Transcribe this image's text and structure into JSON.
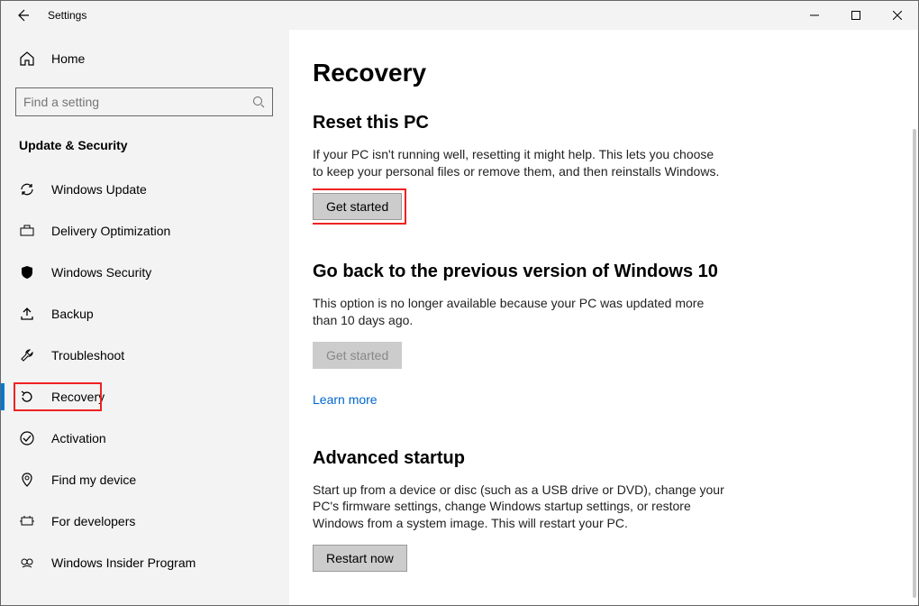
{
  "window": {
    "title": "Settings"
  },
  "home_label": "Home",
  "search": {
    "placeholder": "Find a setting"
  },
  "category": "Update & Security",
  "nav": [
    {
      "id": "windows-update",
      "label": "Windows Update"
    },
    {
      "id": "delivery-optimization",
      "label": "Delivery Optimization"
    },
    {
      "id": "windows-security",
      "label": "Windows Security"
    },
    {
      "id": "backup",
      "label": "Backup"
    },
    {
      "id": "troubleshoot",
      "label": "Troubleshoot"
    },
    {
      "id": "recovery",
      "label": "Recovery",
      "active": true
    },
    {
      "id": "activation",
      "label": "Activation"
    },
    {
      "id": "find-my-device",
      "label": "Find my device"
    },
    {
      "id": "for-developers",
      "label": "For developers"
    },
    {
      "id": "windows-insider",
      "label": "Windows Insider Program"
    }
  ],
  "page": {
    "title": "Recovery",
    "reset": {
      "title": "Reset this PC",
      "desc": "If your PC isn't running well, resetting it might help. This lets you choose to keep your personal files or remove them, and then reinstalls Windows.",
      "button": "Get started"
    },
    "goback": {
      "title": "Go back to the previous version of Windows 10",
      "desc": "This option is no longer available because your PC was updated more than 10 days ago.",
      "button": "Get started",
      "link": "Learn more"
    },
    "advanced": {
      "title": "Advanced startup",
      "desc": "Start up from a device or disc (such as a USB drive or DVD), change your PC's firmware settings, change Windows startup settings, or restore Windows from a system image. This will restart your PC.",
      "button": "Restart now"
    }
  }
}
